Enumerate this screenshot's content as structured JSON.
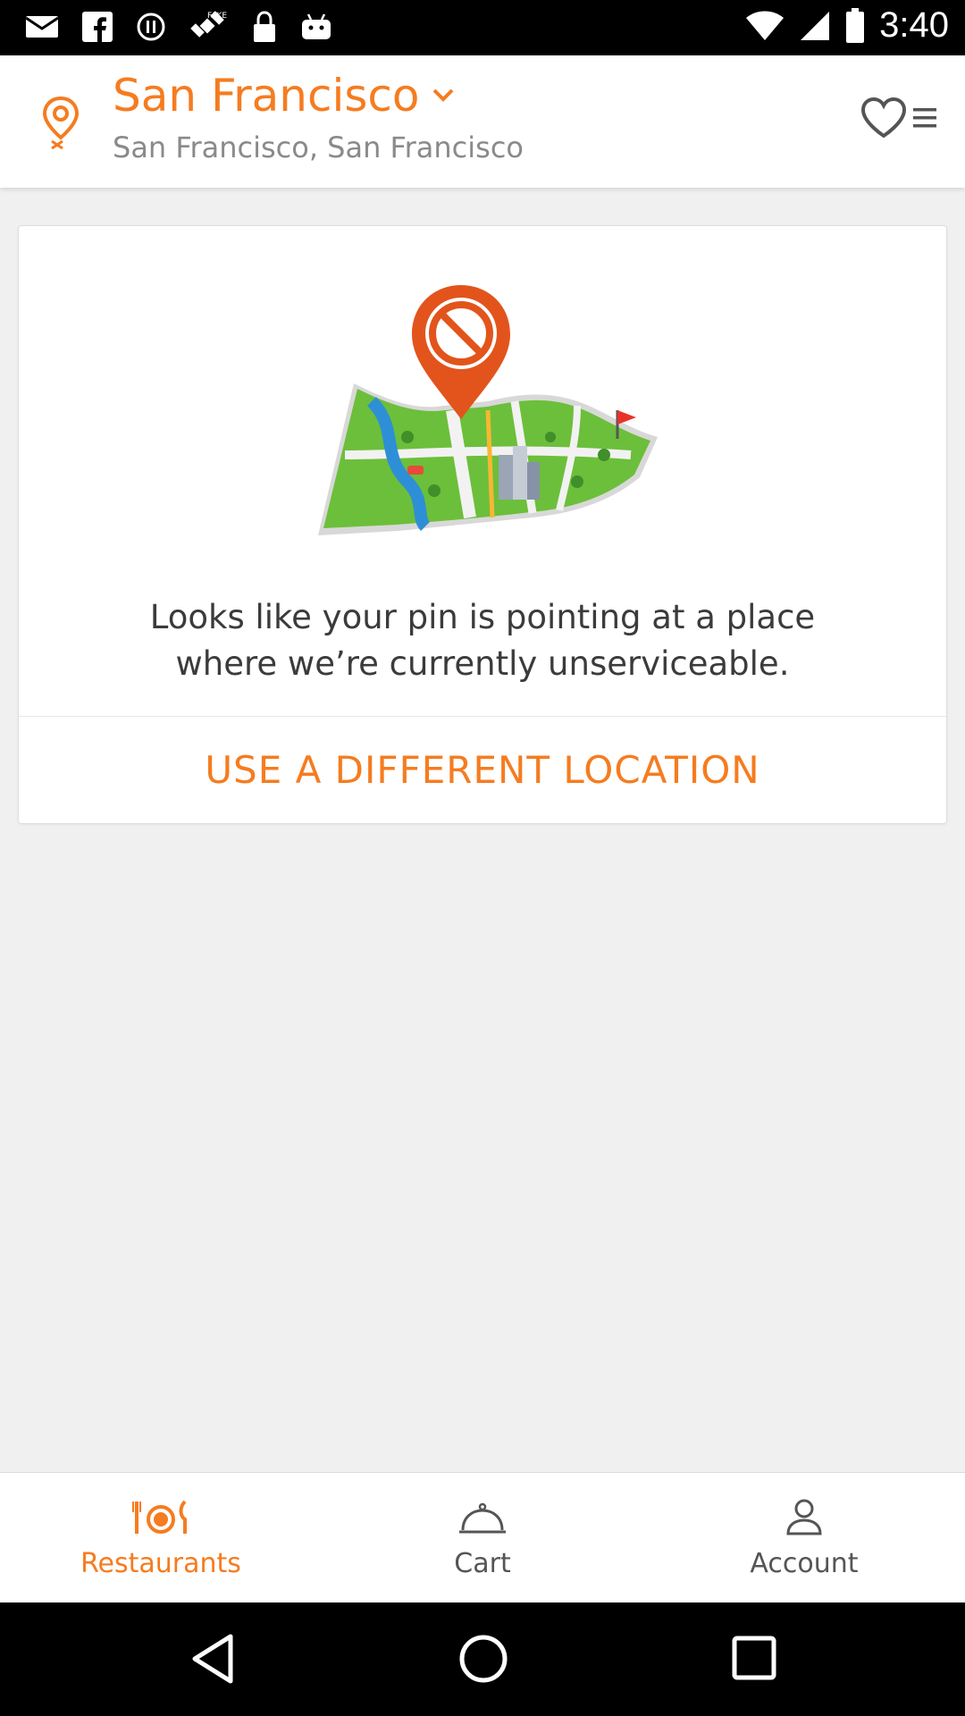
{
  "status_bar": {
    "time": "3:40"
  },
  "header": {
    "city": "San Francisco",
    "address": "San Francisco, San Francisco"
  },
  "unserviceable": {
    "message_line1": "Looks like your pin is pointing at a place",
    "message_line2": "where we’re currently unserviceable.",
    "cta_label": "USE A DIFFERENT LOCATION"
  },
  "bottom_nav": {
    "items": [
      {
        "label": "Restaurants",
        "icon": "restaurant-icon",
        "active": true
      },
      {
        "label": "Cart",
        "icon": "cloche-icon",
        "active": false
      },
      {
        "label": "Account",
        "icon": "user-icon",
        "active": false
      }
    ]
  },
  "colors": {
    "accent": "#f57c20",
    "text_secondary": "#8a8a8a",
    "background": "#f0f0f0"
  }
}
